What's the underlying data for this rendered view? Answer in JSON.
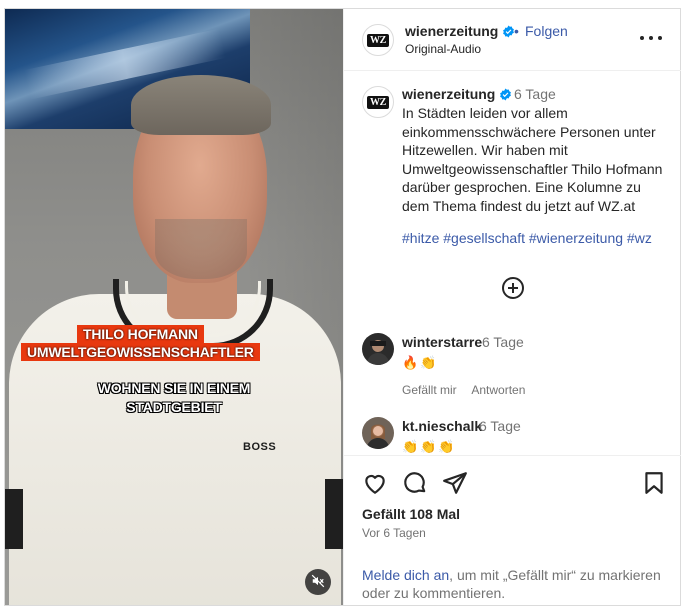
{
  "video": {
    "caption_name": "THILO HOFMANN",
    "caption_role": "UMWELTGEOWISSENSCHAFTLER",
    "subtitle_line1": "WOHNEN SIE IN EINEM",
    "subtitle_line2": "STADTGEBIET",
    "shirt_logo": "BOSS",
    "mute_icon": "speaker-muted-icon"
  },
  "header": {
    "avatar_text": "WZ",
    "username": "wienerzeitung",
    "dot": "•",
    "follow_label": "Folgen",
    "subtitle": "Original-Audio",
    "more_icon": "more-horizontal-icon"
  },
  "post": {
    "avatar_text": "WZ",
    "username": "wienerzeitung",
    "time": "6 Tage",
    "text": "In Städten leiden vor allem einkommensschwächere Personen unter Hitzewellen. Wir haben mit Umweltgeowissenschaftler Thilo Hofmann darüber gesprochen. Eine Kolumne zu dem Thema findest du jetzt auf WZ.at",
    "hashtags": [
      "#hitze",
      "#gesellschaft",
      "#wienerzeitung",
      "#wz"
    ],
    "load_more_icon": "plus-circle-icon"
  },
  "comments": [
    {
      "username": "winterstarre",
      "time": "6 Tage",
      "text": "🔥👏",
      "like_label": "Gefällt mir",
      "reply_label": "Antworten"
    },
    {
      "username": "kt.nieschalk",
      "time": "6 Tage",
      "text": "👏👏👏"
    }
  ],
  "footer": {
    "likes": "Gefällt 108 Mal",
    "date": "Vor 6 Tagen",
    "login_link": "Melde dich an",
    "login_rest": ", um mit „Gefällt mir“ zu markieren oder zu kommentieren."
  },
  "colors": {
    "link_blue": "#3b5aa8",
    "verified_blue": "#0095f6",
    "caption_orange": "#e8380f",
    "muted_text": "#737373"
  }
}
